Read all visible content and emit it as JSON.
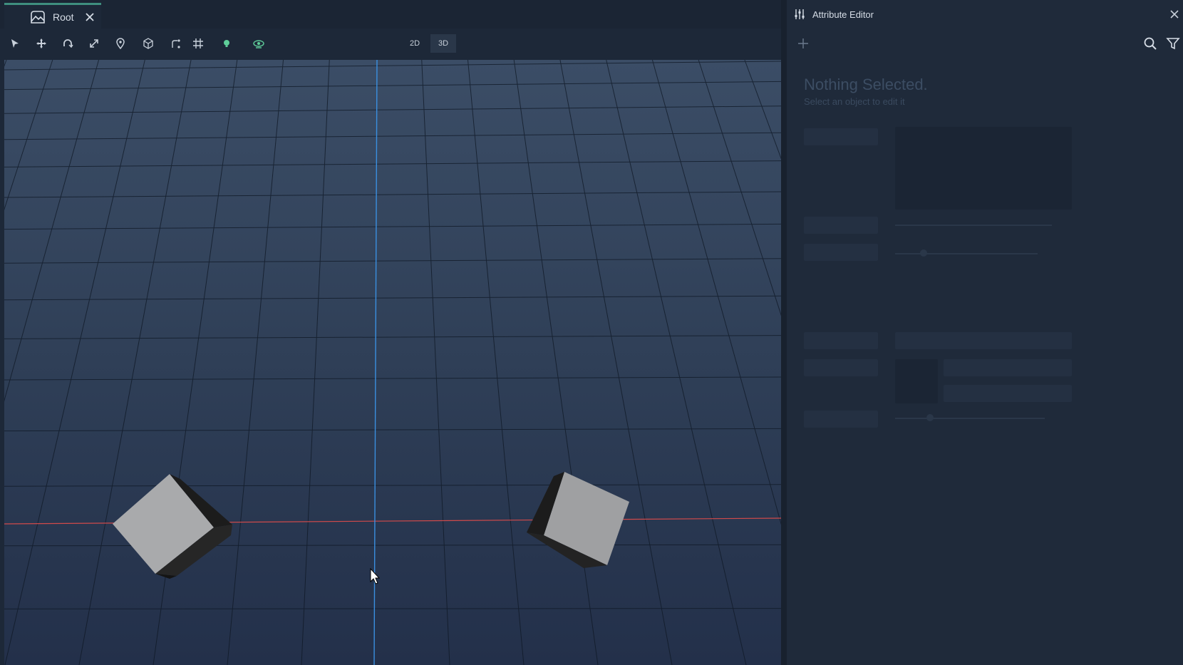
{
  "tabs": [
    {
      "label": "Root",
      "icon": "scene-icon"
    }
  ],
  "toolbar": {
    "tools": [
      "select-icon",
      "move-icon",
      "rotate-icon",
      "scale-icon",
      "pin-icon",
      "object-icon",
      "path-icon",
      "grid-icon",
      "light-icon",
      "camera-icon"
    ],
    "mode_2d": "2D",
    "mode_3d": "3D",
    "active_mode": "3D"
  },
  "attribute_editor": {
    "title": "Attribute Editor",
    "empty_title": "Nothing Selected.",
    "empty_subtitle": "Select an object to edit it"
  },
  "colors": {
    "accent": "#3f8f7f",
    "axis_x": "#d04a4a",
    "axis_z": "#3a8fe0",
    "grid": "#0f1825",
    "active_light": "#5fcf9a"
  }
}
